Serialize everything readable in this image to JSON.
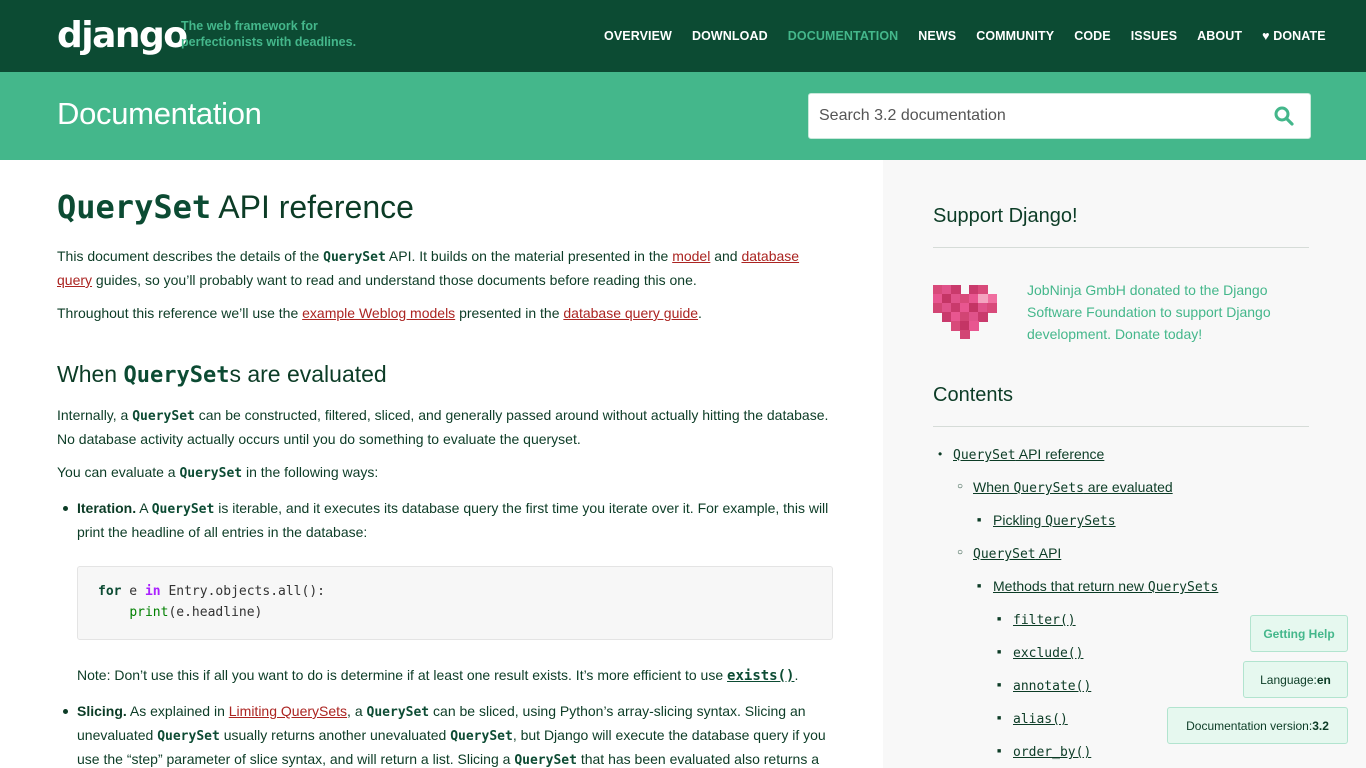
{
  "header": {
    "logo": "django",
    "tagline": "The web framework for perfectionists with deadlines.",
    "nav": [
      "OVERVIEW",
      "DOWNLOAD",
      "DOCUMENTATION",
      "NEWS",
      "COMMUNITY",
      "CODE",
      "ISSUES",
      "ABOUT",
      "♥ DONATE"
    ],
    "active_nav": "DOCUMENTATION"
  },
  "banner": {
    "title": "Documentation",
    "search_placeholder": "Search 3.2 documentation"
  },
  "content": {
    "title_code": "QuerySet",
    "title_rest": " API reference",
    "intro": {
      "t1": "This document describes the details of the ",
      "code1": "QuerySet",
      "t2": " API. It builds on the material presented in the ",
      "link1": "model",
      "t3": " and ",
      "link2": "database query",
      "t4": " guides, so you’ll probably want to read and understand those documents before reading this one."
    },
    "para2": {
      "t1": "Throughout this reference we’ll use the ",
      "link1": "example Weblog models",
      "t2": " presented in the ",
      "link2": "database query guide",
      "t3": "."
    },
    "section_heading": {
      "pre": "When ",
      "code": "QuerySet",
      "post": "s are evaluated"
    },
    "para3": {
      "t1": "Internally, a ",
      "code1": "QuerySet",
      "t2": " can be constructed, filtered, sliced, and generally passed around without actually hitting the database. No database activity actually occurs until you do something to evaluate the queryset."
    },
    "para4": {
      "t1": "You can evaluate a ",
      "code1": "QuerySet",
      "t2": " in the following ways:"
    },
    "bullet1": {
      "label": "Iteration.",
      "t1": " A ",
      "code1": "QuerySet",
      "t2": " is iterable, and it executes its database query the first time you iterate over it. For example, this will print the headline of all entries in the database:"
    },
    "code_block": {
      "kw_for": "for",
      "var": " e ",
      "kw_in": "in",
      "rest1": " Entry.objects.all():",
      "indent": "    ",
      "print": "print",
      "rest2": "(e.headline)"
    },
    "note": {
      "t1": "Note: Don’t use this if all you want to do is determine if at least one result exists. It’s more efficient to use ",
      "code1": "exists()",
      "t2": "."
    },
    "bullet2": {
      "label": "Slicing.",
      "t1": " As explained in ",
      "link1": "Limiting QuerySets",
      "t2": ", a ",
      "code1": "QuerySet",
      "t3": " can be sliced, using Python’s array-slicing syntax. Slicing an unevaluated ",
      "code2": "QuerySet",
      "t4": " usually returns another unevaluated ",
      "code3": "QuerySet",
      "t5": ", but Django will execute the database query if you use the “step” parameter of slice syntax, and will return a list. Slicing a ",
      "code4": "QuerySet",
      "t6": " that has been evaluated also returns a"
    }
  },
  "sidebar": {
    "support_heading": "Support Django!",
    "donor_text": "JobNinja GmbH donated to the Django Software Foundation to support Django development. Donate today!",
    "contents_heading": "Contents",
    "toc": {
      "i1_code": "QuerySet",
      "i1_text": " API reference",
      "i2_text": "When ",
      "i2_code": "QuerySets",
      "i2_post": " are evaluated",
      "i3_text": "Pickling ",
      "i3_code": "QuerySets",
      "i4_code": "QuerySet",
      "i4_text": " API",
      "i5_text": "Methods that return new ",
      "i5_code": "QuerySets",
      "i6": "filter()",
      "i7": "exclude()",
      "i8": "annotate()",
      "i9": "alias()",
      "i10": "order_by()"
    }
  },
  "floating": {
    "help": "Getting Help",
    "language_label": "Language: ",
    "language_value": "en",
    "version_label": "Documentation version: ",
    "version_value": "3.2"
  },
  "colors": {
    "header_bg": "#0c4b33",
    "banner_bg": "#44b78b",
    "link": "#ab2421"
  }
}
